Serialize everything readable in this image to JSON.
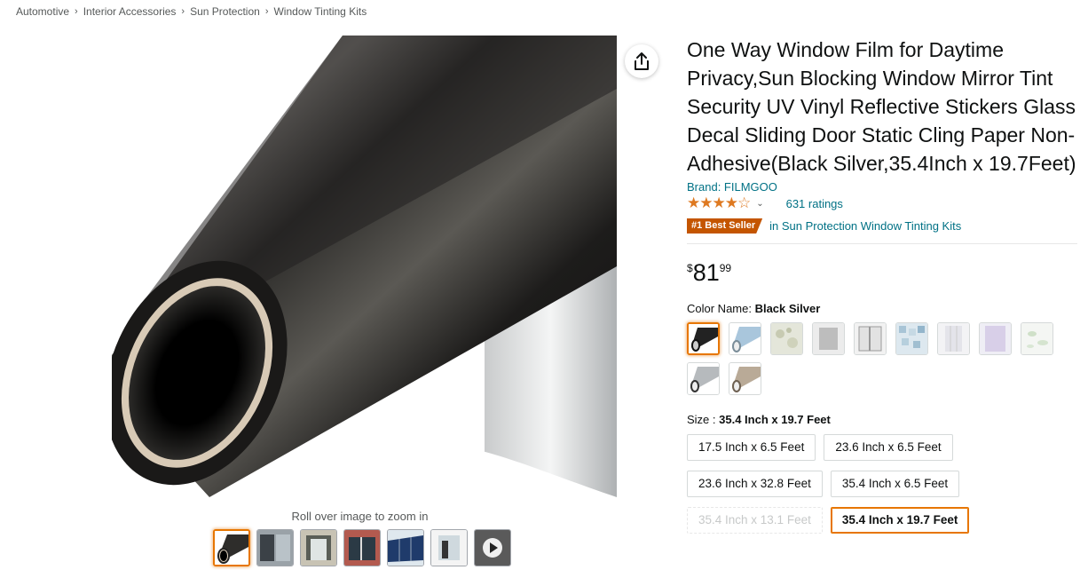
{
  "breadcrumb": [
    "Automotive",
    "Interior Accessories",
    "Sun Protection",
    "Window Tinting Kits"
  ],
  "product": {
    "title": "One Way Window Film for Daytime Privacy,Sun Blocking Window Mirror Tint Security UV Vinyl Reflective Stickers Glass Decal Sliding Door Static Cling Paper Non-Adhesive(Black Silver,35.4Inch x 19.7Feet)",
    "brand": "Brand: FILMGOO",
    "stars": "★★★★☆",
    "rating_value": 4.2,
    "ratings_count": "631 ratings",
    "best_seller_badge": "#1 Best Seller",
    "best_seller_category": "in Sun Protection Window Tinting Kits",
    "price": {
      "symbol": "$",
      "whole": "81",
      "fraction": "99"
    }
  },
  "gallery": {
    "zoom_hint": "Roll over image to zoom in",
    "thumbnail_count": 7,
    "selected_thumbnail": 0,
    "video_thumbnail_label": "VIDEO"
  },
  "color": {
    "label": "Color Name: ",
    "selected": "Black Silver",
    "swatches": [
      "black-silver",
      "blue-silver",
      "floral",
      "frosted-gray",
      "frosted-white",
      "mosaic",
      "white-pattern",
      "purple",
      "leaf",
      "silver",
      "bronze"
    ]
  },
  "size": {
    "label": "Size : ",
    "selected": "35.4 Inch x 19.7 Feet",
    "options": [
      "17.5 Inch x 6.5 Feet",
      "23.6 Inch x 6.5 Feet",
      "23.6 Inch x 32.8 Feet",
      "35.4 Inch x 6.5 Feet",
      "35.4 Inch x 13.1 Feet",
      "35.4 Inch x 19.7 Feet"
    ],
    "unavailable": [
      "35.4 Inch x 13.1 Feet"
    ]
  },
  "icons": {
    "share": "share-icon",
    "ratings_dropdown": "chevron-down-icon"
  },
  "colors": {
    "link": "#007185",
    "star": "#de7921",
    "badge": "#c45500",
    "selection": "#e77600"
  }
}
